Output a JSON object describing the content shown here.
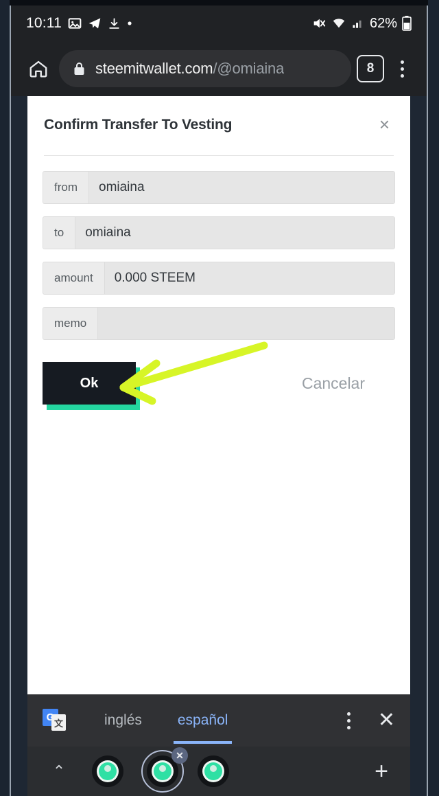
{
  "status_bar": {
    "time": "10:11",
    "left_icons": [
      "image-icon",
      "telegram-icon",
      "download-icon",
      "dot-icon"
    ],
    "right_icons": [
      "mute-icon",
      "wifi-icon",
      "signal-icon",
      "battery-icon"
    ],
    "battery_percent": "62%"
  },
  "browser": {
    "home_icon": "home-icon",
    "lock_icon": "lock-icon",
    "url_visible": "steemitwallet.com",
    "url_dim": "/@omiaina",
    "tab_count": "8",
    "menu_icon": "overflow-menu-icon"
  },
  "modal": {
    "title": "Confirm Transfer To Vesting",
    "close_label": "×",
    "fields": [
      {
        "label": "from",
        "value": "omiaina"
      },
      {
        "label": "to",
        "value": "omiaina"
      },
      {
        "label": "amount",
        "value": "0.000 STEEM"
      },
      {
        "label": "memo",
        "value": ""
      }
    ],
    "ok_label": "Ok",
    "cancel_label": "Cancelar",
    "ok_button_color": "#161b22",
    "ok_shadow_color": "#24d6a0",
    "annotation_arrow_color": "#d7f527"
  },
  "translate_bar": {
    "icon": "google-translate-icon",
    "icon_letter": "G",
    "icon_glyph": "文",
    "source_language": "inglés",
    "target_language": "español",
    "selected_language": "español",
    "accent_color": "#8ab4f8",
    "menu_icon": "overflow-menu-icon",
    "close_label": "✕"
  },
  "tab_strip": {
    "expand_label": "⌃",
    "tabs": [
      {
        "name": "tab-1",
        "selected": false
      },
      {
        "name": "tab-2",
        "selected": true,
        "close_badge": "✕"
      },
      {
        "name": "tab-3",
        "selected": false
      }
    ],
    "new_tab_label": "+"
  }
}
